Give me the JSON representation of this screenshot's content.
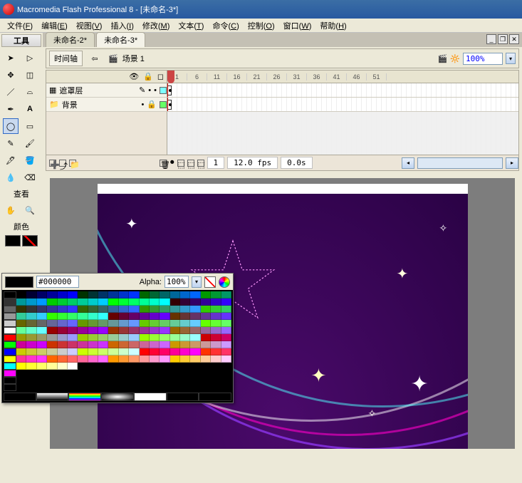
{
  "titlebar": {
    "app": "Macromedia Flash Professional 8 - [未命名-3*]"
  },
  "menubar": {
    "items": [
      {
        "label": "文件",
        "key": "F"
      },
      {
        "label": "编辑",
        "key": "E"
      },
      {
        "label": "视图",
        "key": "V"
      },
      {
        "label": "插入",
        "key": "I"
      },
      {
        "label": "修改",
        "key": "M"
      },
      {
        "label": "文本",
        "key": "T"
      },
      {
        "label": "命令",
        "key": "C"
      },
      {
        "label": "控制",
        "key": "O"
      },
      {
        "label": "窗口",
        "key": "W"
      },
      {
        "label": "帮助",
        "key": "H"
      }
    ]
  },
  "tool_panel": {
    "title": "工具",
    "view_label": "查看",
    "color_label": "颜色"
  },
  "doc_tabs": {
    "tabs": [
      "未命名-2*",
      "未命名-3*"
    ],
    "active": 1
  },
  "scene_bar": {
    "timeline_btn": "时间轴",
    "scene_label": "场景 1",
    "zoom": "100%"
  },
  "timeline": {
    "ruler_step": 5,
    "ruler_max": 55,
    "layers": [
      {
        "name": "遮罩层",
        "type": "mask",
        "color": "#7fffff"
      },
      {
        "name": "背景",
        "type": "folder",
        "color": "#66ff66"
      }
    ],
    "current_frame": "1",
    "fps": "12.0 fps",
    "time": "0.0s"
  },
  "color_picker": {
    "hex": "#000000",
    "alpha_label": "Alpha:",
    "alpha": "100%"
  },
  "colors": {
    "menu_bg": "#ece9d8",
    "titlebar": "#2859a0"
  }
}
